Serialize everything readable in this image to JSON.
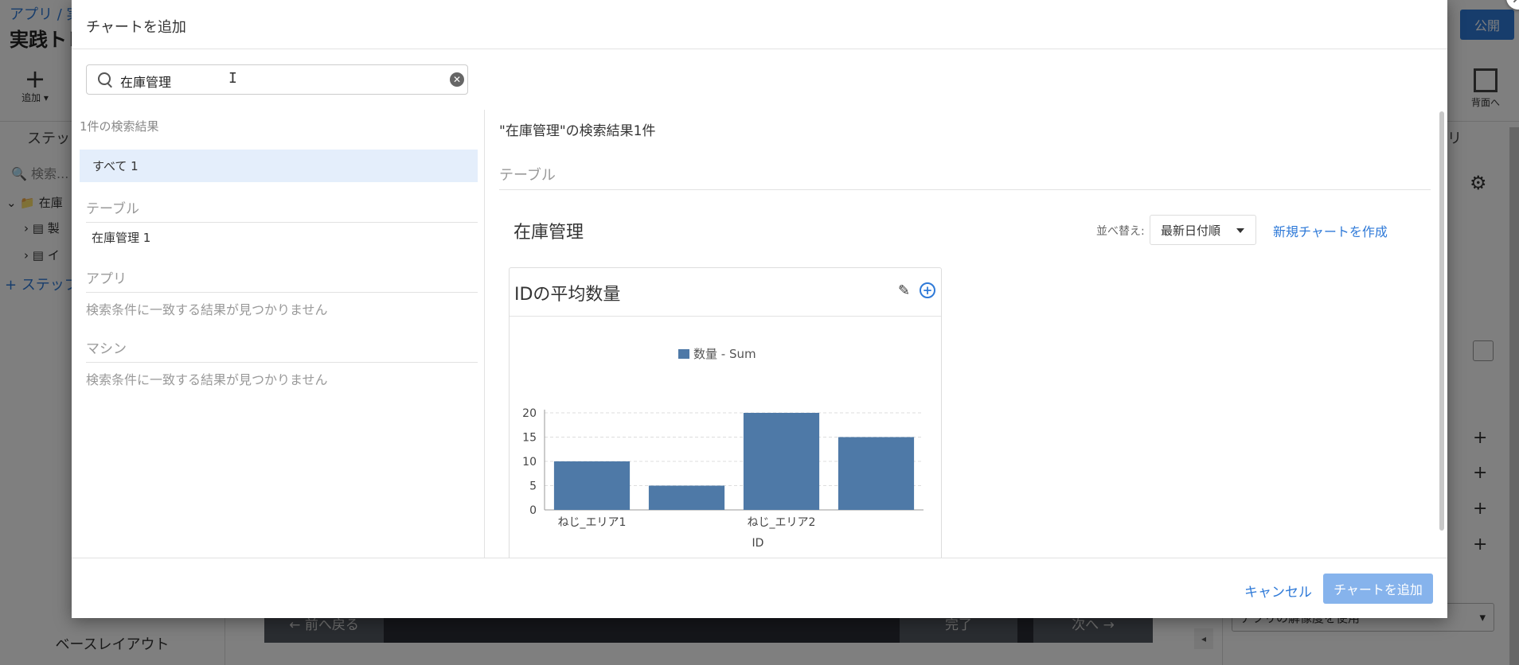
{
  "background": {
    "breadcrumb": "アプリ / 実",
    "app_title": "実践トレ",
    "publish_label": "公開",
    "add_label": "追加",
    "send_back_label": "背面へ",
    "left_tab": "ステップ",
    "left_search_placeholder": "検索...",
    "tree": [
      "在庫",
      "製",
      "イ"
    ],
    "add_step": "+ ステップ",
    "base_layout": "ベースレイアウト",
    "right_tab": "プリ",
    "right_select": "アプリの解像度を使用",
    "prev_button": "← 前へ戻る",
    "done_button": "完了",
    "next_button": "次へ →"
  },
  "modal": {
    "title": "チャートを追加",
    "search": {
      "value": "在庫管理"
    },
    "results_count": "1件の検索結果",
    "all_item": "すべて 1",
    "sections": {
      "table": {
        "header": "テーブル",
        "item": "在庫管理 1"
      },
      "app": {
        "header": "アプリ",
        "empty": "検索条件に一致する結果が見つかりません"
      },
      "machine": {
        "header": "マシン",
        "empty": "検索条件に一致する結果が見つかりません"
      }
    },
    "result_heading": "\"在庫管理\"の検索結果1件",
    "section_label": "テーブル",
    "table_name": "在庫管理",
    "sort_label": "並べ替え:",
    "sort_value": "最新日付順",
    "new_chart_link": "新規チャートを作成",
    "chart_card_title": "IDの平均数量",
    "cancel_label": "キャンセル",
    "submit_label": "チャートを追加"
  },
  "chart_data": {
    "type": "bar",
    "categories": [
      "ねじ_エリア1",
      "",
      "ねじ_エリア2",
      ""
    ],
    "series": [
      {
        "name": "数量 - Sum",
        "values": [
          10,
          5,
          20,
          15
        ],
        "color": "#4e79a7"
      }
    ],
    "xlabel": "ID",
    "ylabel": "",
    "ylim": [
      0,
      20
    ],
    "yticks": [
      0,
      5,
      10,
      15,
      20
    ],
    "grid": true,
    "legend": "top-center"
  }
}
